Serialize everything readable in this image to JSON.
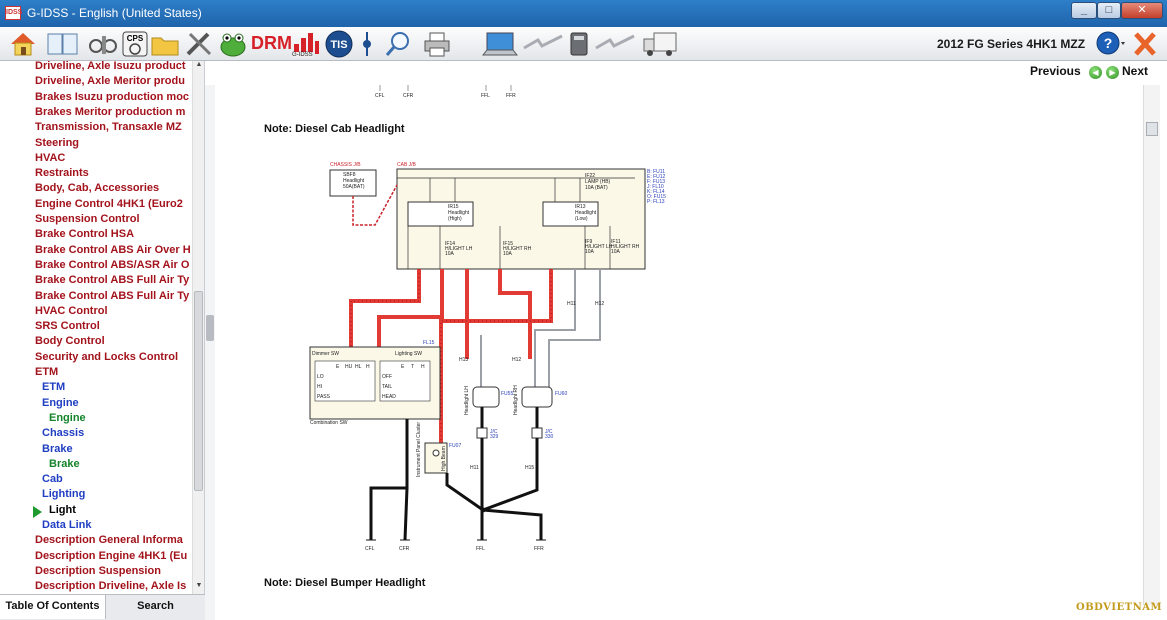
{
  "window": {
    "title": "G-IDSS - English (United States)",
    "app_icon_text": "IDSS",
    "minimize": "_",
    "maximize": "□",
    "close": "✕"
  },
  "toolbar": {
    "drm_label": "DRM",
    "idss_badge": "G-IDSS",
    "cps_label": "CPS",
    "tis_label": "TIS",
    "vehicle_title": "2012 FG Series 4HK1 MZZ",
    "help_label": "?"
  },
  "nav": {
    "previous": "Previous",
    "next": "Next"
  },
  "sidebar": {
    "items": [
      {
        "label": "Driveline, Axle Isuzu product",
        "style": "red",
        "indent": 0
      },
      {
        "label": "Driveline, Axle Meritor produ",
        "style": "red",
        "indent": 0
      },
      {
        "label": "Brakes Isuzu production moc",
        "style": "red",
        "indent": 0
      },
      {
        "label": "Brakes Meritor production m",
        "style": "red",
        "indent": 0
      },
      {
        "label": "Transmission, Transaxle MZ",
        "style": "red",
        "indent": 0
      },
      {
        "label": "Steering",
        "style": "red",
        "indent": 0
      },
      {
        "label": "HVAC",
        "style": "red",
        "indent": 0
      },
      {
        "label": "Restraints",
        "style": "red",
        "indent": 0
      },
      {
        "label": "Body, Cab, Accessories",
        "style": "red",
        "indent": 0
      },
      {
        "label": "Engine Control 4HK1 (Euro2",
        "style": "red",
        "indent": 0
      },
      {
        "label": "Suspension Control",
        "style": "red",
        "indent": 0
      },
      {
        "label": "Brake Control HSA",
        "style": "red",
        "indent": 0
      },
      {
        "label": "Brake Control ABS Air Over H",
        "style": "red",
        "indent": 0
      },
      {
        "label": "Brake Control ABS/ASR Air O",
        "style": "red",
        "indent": 0
      },
      {
        "label": "Brake Control ABS Full Air Ty",
        "style": "red",
        "indent": 0
      },
      {
        "label": "Brake Control ABS Full Air Ty",
        "style": "red",
        "indent": 0
      },
      {
        "label": "HVAC Control",
        "style": "red",
        "indent": 0
      },
      {
        "label": "SRS Control",
        "style": "red",
        "indent": 0
      },
      {
        "label": "Body Control",
        "style": "red",
        "indent": 0
      },
      {
        "label": "Security and Locks Control",
        "style": "red",
        "indent": 0
      },
      {
        "label": "ETM",
        "style": "red",
        "indent": 0
      },
      {
        "label": "ETM",
        "style": "blue",
        "indent": 1
      },
      {
        "label": "Engine",
        "style": "blue",
        "indent": 1
      },
      {
        "label": "Engine",
        "style": "green",
        "indent": 2
      },
      {
        "label": "Chassis",
        "style": "blue",
        "indent": 1
      },
      {
        "label": "Brake",
        "style": "blue",
        "indent": 1
      },
      {
        "label": "Brake",
        "style": "green",
        "indent": 2
      },
      {
        "label": "Cab",
        "style": "blue",
        "indent": 1
      },
      {
        "label": "Lighting",
        "style": "blue",
        "indent": 1
      },
      {
        "label": "Light",
        "style": "black",
        "indent": 2
      },
      {
        "label": "Data Link",
        "style": "blue",
        "indent": 1
      },
      {
        "label": "Description General Informa",
        "style": "red",
        "indent": 0
      },
      {
        "label": "Description Engine 4HK1 (Eu",
        "style": "red",
        "indent": 0
      },
      {
        "label": "Description Suspension",
        "style": "red",
        "indent": 0
      },
      {
        "label": "Description Driveline, Axle Is",
        "style": "red",
        "indent": 0
      }
    ],
    "tab_toc": "Table Of Contents",
    "tab_search": "Search"
  },
  "content": {
    "note_cab": "Note: Diesel Cab Headlight",
    "note_bumper": "Note: Diesel Bumper Headlight",
    "top_grounds": [
      "CFL",
      "CFR",
      "FFL",
      "FFR"
    ],
    "diagram": {
      "chassis_jb": "CHASSIS J/B",
      "cab_jb": "CAB J/B",
      "sbf8": "SBF8",
      "sbf8_desc1": "Headlight",
      "sbf8_desc2": "50A(BAT)",
      "if22": "IF22",
      "if22_desc1": "LAMP (HB)",
      "if22_desc2": "10A (BAT)",
      "ir15": "IR15",
      "ir15_desc1": "Headlight",
      "ir15_desc2": "(High)",
      "ir13": "IR13",
      "ir13_desc1": "Headlight",
      "ir13_desc2": "(Low)",
      "if14": "IF14",
      "if14_desc": "H/LIGHT LH",
      "if15": "IF15",
      "if15_desc": "H/LIGHT RH",
      "if9": "IF9",
      "if9_desc": "H/LIGHT LH",
      "if11": "IF11",
      "if11_desc": "H/LIGHT RH",
      "amp10": "10A",
      "conn_legend": [
        "B: FU11",
        "E: FU12",
        "F: FU13",
        "J: FL10",
        "K: FL14",
        "O: FU15",
        "P: FL13"
      ],
      "dimmer_sw": "Dimmer SW",
      "lighting_sw": "Lighting SW",
      "combination_sw": "Combination SW",
      "fl15": "FL15",
      "dimmer_cols": [
        "E",
        "HU",
        "HL",
        "H"
      ],
      "dimmer_rows": [
        "LO",
        "HI",
        "PASS"
      ],
      "lighting_cols": [
        "E",
        "T",
        "H"
      ],
      "lighting_rows": [
        "OFF",
        "TAIL",
        "HEAD"
      ],
      "instrument_panel": "Instrument Panel Cluster",
      "high_beam": "High Beam",
      "fu07": "FU07",
      "headlight_lh": "Headlight LH",
      "headlight_rh": "Headlight RH",
      "fu55": "FU55",
      "fu60": "FU60",
      "jc1": "J/C",
      "jc1b": "329",
      "jc2": "J/C",
      "jc2b": "330",
      "h11": "H11",
      "h12": "H12",
      "h13": "H13",
      "h15": "H15",
      "grounds": [
        "CFL",
        "CFR",
        "FFL",
        "FFR"
      ]
    }
  },
  "watermark": "OBDVIETNAM",
  "colors": {
    "title_bar": "#1f64ab",
    "toc_red": "#a3131c",
    "toc_blue": "#1f3ec2",
    "toc_green": "#13842a",
    "wire_red": "#e23b33"
  }
}
